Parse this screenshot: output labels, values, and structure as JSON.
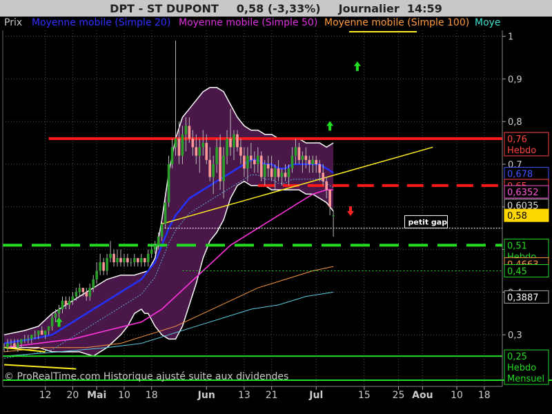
{
  "header": {
    "instrument": "DPT - ST DUPONT",
    "quote": "0,58 (-3,33%)",
    "period": "Journalier",
    "time": "14:59"
  },
  "legend": [
    {
      "label": "Prix",
      "color": "#c8c8c8"
    },
    {
      "label": "Moyenne mobile (Simple 20)",
      "color": "#3030ff"
    },
    {
      "label": "Moyenne mobile (Simple 50)",
      "color": "#e030e0"
    },
    {
      "label": "Moyenne mobile (Simple 100)",
      "color": "#ff9a40"
    },
    {
      "label": "Moye",
      "color": "#40e0d0"
    }
  ],
  "footer_note": "© ProRealTime.com Historique ajusté suite aux dividendes",
  "colors": {
    "background": "#000000",
    "bollinger_fill": "#4a1848",
    "bollinger_edge": "#ffffff",
    "candle_up": "#2aa02a",
    "candle_down": "#ff9999",
    "resistance": "#ff1a1a",
    "support": "#22dd22",
    "trendline": "#ffee22",
    "sma20": "#2233ff",
    "sma50": "#ff33dd",
    "sma100": "#ff9a40",
    "sma200": "#5ad0e0"
  },
  "chart_data": {
    "type": "candlestick",
    "y_axis": {
      "min": 0.2,
      "max": 1.0,
      "ticks": [
        "1",
        "0,9",
        "0,8",
        "0,7",
        "0,6",
        "0,5",
        "0,4",
        "0,3"
      ]
    },
    "x_axis": {
      "labels": [
        {
          "text": "12",
          "day": 12,
          "bold": false
        },
        {
          "text": "20",
          "day": 20,
          "bold": false
        },
        {
          "text": "Mai",
          "day": 27,
          "bold": true
        },
        {
          "text": "10",
          "day": 35,
          "bold": false
        },
        {
          "text": "18",
          "day": 43,
          "bold": false
        },
        {
          "text": "Jun",
          "day": 59,
          "bold": true
        },
        {
          "text": "13",
          "day": 70,
          "bold": false
        },
        {
          "text": "21",
          "day": 78,
          "bold": false
        },
        {
          "text": "Jul",
          "day": 91,
          "bold": true
        },
        {
          "text": "15",
          "day": 105,
          "bold": false
        },
        {
          "text": "25",
          "day": 115,
          "bold": false
        },
        {
          "text": "Aou",
          "day": 122,
          "bold": true
        },
        {
          "text": "10",
          "day": 132,
          "bold": false
        },
        {
          "text": "18",
          "day": 140,
          "bold": false
        }
      ]
    },
    "candles": [
      [
        0.27,
        0.28,
        0.26,
        0.27
      ],
      [
        0.27,
        0.29,
        0.26,
        0.28
      ],
      [
        0.28,
        0.29,
        0.27,
        0.28
      ],
      [
        0.28,
        0.29,
        0.27,
        0.27
      ],
      [
        0.27,
        0.29,
        0.26,
        0.28
      ],
      [
        0.28,
        0.29,
        0.27,
        0.29
      ],
      [
        0.29,
        0.3,
        0.28,
        0.29
      ],
      [
        0.29,
        0.3,
        0.28,
        0.29
      ],
      [
        0.29,
        0.3,
        0.28,
        0.3
      ],
      [
        0.3,
        0.31,
        0.29,
        0.3
      ],
      [
        0.3,
        0.31,
        0.29,
        0.31
      ],
      [
        0.31,
        0.32,
        0.3,
        0.3
      ],
      [
        0.3,
        0.31,
        0.29,
        0.31
      ],
      [
        0.31,
        0.32,
        0.3,
        0.32
      ],
      [
        0.32,
        0.35,
        0.31,
        0.34
      ],
      [
        0.34,
        0.36,
        0.33,
        0.35
      ],
      [
        0.35,
        0.37,
        0.34,
        0.36
      ],
      [
        0.36,
        0.39,
        0.35,
        0.38
      ],
      [
        0.38,
        0.39,
        0.36,
        0.37
      ],
      [
        0.37,
        0.39,
        0.36,
        0.38
      ],
      [
        0.38,
        0.4,
        0.37,
        0.39
      ],
      [
        0.39,
        0.41,
        0.38,
        0.4
      ],
      [
        0.4,
        0.42,
        0.39,
        0.41
      ],
      [
        0.41,
        0.4,
        0.39,
        0.4
      ],
      [
        0.4,
        0.41,
        0.38,
        0.39
      ],
      [
        0.39,
        0.42,
        0.38,
        0.41
      ],
      [
        0.41,
        0.44,
        0.4,
        0.43
      ],
      [
        0.43,
        0.47,
        0.42,
        0.45
      ],
      [
        0.45,
        0.49,
        0.44,
        0.47
      ],
      [
        0.47,
        0.48,
        0.44,
        0.45
      ],
      [
        0.45,
        0.49,
        0.44,
        0.48
      ],
      [
        0.48,
        0.52,
        0.47,
        0.49
      ],
      [
        0.49,
        0.5,
        0.46,
        0.47
      ],
      [
        0.47,
        0.5,
        0.46,
        0.48
      ],
      [
        0.48,
        0.5,
        0.46,
        0.47
      ],
      [
        0.47,
        0.49,
        0.46,
        0.48
      ],
      [
        0.48,
        0.49,
        0.46,
        0.47
      ],
      [
        0.47,
        0.48,
        0.46,
        0.47
      ],
      [
        0.47,
        0.49,
        0.46,
        0.48
      ],
      [
        0.48,
        0.48,
        0.46,
        0.47
      ],
      [
        0.47,
        0.49,
        0.46,
        0.48
      ],
      [
        0.48,
        0.48,
        0.46,
        0.47
      ],
      [
        0.47,
        0.5,
        0.46,
        0.49
      ],
      [
        0.49,
        0.51,
        0.48,
        0.5
      ],
      [
        0.5,
        0.52,
        0.49,
        0.51
      ],
      [
        0.51,
        0.54,
        0.5,
        0.53
      ],
      [
        0.53,
        0.57,
        0.52,
        0.56
      ],
      [
        0.56,
        0.62,
        0.55,
        0.61
      ],
      [
        0.61,
        0.72,
        0.6,
        0.7
      ],
      [
        0.7,
        0.76,
        0.69,
        0.74
      ],
      [
        0.74,
        0.99,
        0.72,
        0.76
      ],
      [
        0.76,
        0.8,
        0.7,
        0.72
      ],
      [
        0.72,
        0.79,
        0.7,
        0.77
      ],
      [
        0.77,
        0.81,
        0.73,
        0.79
      ],
      [
        0.79,
        0.81,
        0.75,
        0.76
      ],
      [
        0.76,
        0.78,
        0.72,
        0.74
      ],
      [
        0.74,
        0.77,
        0.7,
        0.72
      ],
      [
        0.72,
        0.76,
        0.68,
        0.74
      ],
      [
        0.74,
        0.78,
        0.72,
        0.75
      ],
      [
        0.75,
        0.77,
        0.7,
        0.71
      ],
      [
        0.71,
        0.74,
        0.66,
        0.67
      ],
      [
        0.67,
        0.72,
        0.63,
        0.7
      ],
      [
        0.7,
        0.76,
        0.68,
        0.74
      ],
      [
        0.74,
        0.77,
        0.64,
        0.66
      ],
      [
        0.66,
        0.74,
        0.62,
        0.72
      ],
      [
        0.72,
        0.78,
        0.7,
        0.76
      ],
      [
        0.76,
        0.83,
        0.72,
        0.74
      ],
      [
        0.74,
        0.78,
        0.71,
        0.77
      ],
      [
        0.77,
        0.78,
        0.73,
        0.74
      ],
      [
        0.74,
        0.76,
        0.7,
        0.72
      ],
      [
        0.72,
        0.74,
        0.67,
        0.69
      ],
      [
        0.69,
        0.74,
        0.66,
        0.72
      ],
      [
        0.72,
        0.75,
        0.69,
        0.71
      ],
      [
        0.71,
        0.73,
        0.68,
        0.7
      ],
      [
        0.7,
        0.74,
        0.68,
        0.72
      ],
      [
        0.72,
        0.73,
        0.66,
        0.67
      ],
      [
        0.67,
        0.71,
        0.65,
        0.7
      ],
      [
        0.7,
        0.72,
        0.67,
        0.69
      ],
      [
        0.69,
        0.72,
        0.66,
        0.67
      ],
      [
        0.67,
        0.7,
        0.64,
        0.69
      ],
      [
        0.69,
        0.71,
        0.66,
        0.67
      ],
      [
        0.67,
        0.69,
        0.65,
        0.68
      ],
      [
        0.68,
        0.7,
        0.66,
        0.67
      ],
      [
        0.67,
        0.7,
        0.65,
        0.69
      ],
      [
        0.69,
        0.74,
        0.68,
        0.72
      ],
      [
        0.72,
        0.76,
        0.7,
        0.74
      ],
      [
        0.74,
        0.75,
        0.7,
        0.71
      ],
      [
        0.71,
        0.73,
        0.68,
        0.72
      ],
      [
        0.72,
        0.74,
        0.69,
        0.71
      ],
      [
        0.71,
        0.72,
        0.68,
        0.7
      ],
      [
        0.7,
        0.72,
        0.68,
        0.71
      ],
      [
        0.71,
        0.72,
        0.68,
        0.7
      ],
      [
        0.7,
        0.71,
        0.66,
        0.68
      ],
      [
        0.68,
        0.7,
        0.65,
        0.66
      ],
      [
        0.66,
        0.67,
        0.62,
        0.64
      ],
      [
        0.64,
        0.64,
        0.58,
        0.6
      ],
      [
        0.58,
        0.59,
        0.53,
        0.58
      ]
    ],
    "bollinger_upper": [
      [
        0,
        0.3
      ],
      [
        6,
        0.31
      ],
      [
        10,
        0.32
      ],
      [
        14,
        0.35
      ],
      [
        20,
        0.38
      ],
      [
        26,
        0.41
      ],
      [
        30,
        0.43
      ],
      [
        34,
        0.44
      ],
      [
        38,
        0.44
      ],
      [
        42,
        0.45
      ],
      [
        44,
        0.48
      ],
      [
        46,
        0.57
      ],
      [
        48,
        0.68
      ],
      [
        50,
        0.76
      ],
      [
        52,
        0.81
      ],
      [
        54,
        0.83
      ],
      [
        56,
        0.85
      ],
      [
        58,
        0.87
      ],
      [
        60,
        0.88
      ],
      [
        62,
        0.88
      ],
      [
        64,
        0.87
      ],
      [
        66,
        0.84
      ],
      [
        68,
        0.81
      ],
      [
        70,
        0.79
      ],
      [
        72,
        0.78
      ],
      [
        74,
        0.78
      ],
      [
        76,
        0.77
      ],
      [
        78,
        0.77
      ],
      [
        80,
        0.76
      ],
      [
        82,
        0.76
      ],
      [
        84,
        0.76
      ],
      [
        86,
        0.76
      ],
      [
        88,
        0.75
      ],
      [
        90,
        0.75
      ],
      [
        92,
        0.75
      ],
      [
        94,
        0.74
      ],
      [
        96,
        0.75
      ]
    ],
    "bollinger_lower": [
      [
        0,
        0.27
      ],
      [
        6,
        0.27
      ],
      [
        10,
        0.27
      ],
      [
        14,
        0.26
      ],
      [
        18,
        0.26
      ],
      [
        22,
        0.26
      ],
      [
        26,
        0.25
      ],
      [
        30,
        0.27
      ],
      [
        34,
        0.3
      ],
      [
        36,
        0.32
      ],
      [
        38,
        0.35
      ],
      [
        40,
        0.36
      ],
      [
        41,
        0.35
      ],
      [
        42,
        0.35
      ],
      [
        44,
        0.32
      ],
      [
        46,
        0.3
      ],
      [
        48,
        0.29
      ],
      [
        50,
        0.29
      ],
      [
        52,
        0.32
      ],
      [
        54,
        0.37
      ],
      [
        56,
        0.42
      ],
      [
        58,
        0.48
      ],
      [
        60,
        0.52
      ],
      [
        62,
        0.54
      ],
      [
        64,
        0.57
      ],
      [
        66,
        0.62
      ],
      [
        68,
        0.65
      ],
      [
        70,
        0.66
      ],
      [
        72,
        0.65
      ],
      [
        74,
        0.65
      ],
      [
        76,
        0.65
      ],
      [
        78,
        0.64
      ],
      [
        80,
        0.64
      ],
      [
        82,
        0.64
      ],
      [
        84,
        0.64
      ],
      [
        86,
        0.64
      ],
      [
        88,
        0.63
      ],
      [
        90,
        0.63
      ],
      [
        92,
        0.62
      ],
      [
        94,
        0.61
      ],
      [
        96,
        0.59
      ]
    ],
    "sma20": [
      [
        0,
        0.28
      ],
      [
        8,
        0.29
      ],
      [
        14,
        0.3
      ],
      [
        18,
        0.32
      ],
      [
        24,
        0.35
      ],
      [
        30,
        0.38
      ],
      [
        36,
        0.41
      ],
      [
        40,
        0.43
      ],
      [
        42,
        0.45
      ],
      [
        44,
        0.47
      ],
      [
        46,
        0.51
      ],
      [
        48,
        0.55
      ],
      [
        50,
        0.58
      ],
      [
        52,
        0.6
      ],
      [
        54,
        0.62
      ],
      [
        56,
        0.63
      ],
      [
        58,
        0.64
      ],
      [
        60,
        0.65
      ],
      [
        62,
        0.66
      ],
      [
        64,
        0.67
      ],
      [
        66,
        0.68
      ],
      [
        68,
        0.69
      ],
      [
        70,
        0.7
      ],
      [
        72,
        0.71
      ],
      [
        74,
        0.71
      ],
      [
        76,
        0.7
      ],
      [
        78,
        0.7
      ],
      [
        80,
        0.69
      ],
      [
        82,
        0.69
      ],
      [
        84,
        0.7
      ],
      [
        86,
        0.7
      ],
      [
        88,
        0.7
      ],
      [
        90,
        0.7
      ],
      [
        92,
        0.7
      ],
      [
        94,
        0.69
      ],
      [
        96,
        0.68
      ]
    ],
    "sma50": [
      [
        0,
        0.27
      ],
      [
        10,
        0.28
      ],
      [
        20,
        0.29
      ],
      [
        30,
        0.31
      ],
      [
        40,
        0.33
      ],
      [
        46,
        0.36
      ],
      [
        50,
        0.39
      ],
      [
        54,
        0.42
      ],
      [
        58,
        0.45
      ],
      [
        62,
        0.48
      ],
      [
        66,
        0.51
      ],
      [
        70,
        0.53
      ],
      [
        74,
        0.55
      ],
      [
        78,
        0.57
      ],
      [
        82,
        0.59
      ],
      [
        86,
        0.61
      ],
      [
        90,
        0.63
      ],
      [
        94,
        0.64
      ],
      [
        96,
        0.64
      ]
    ],
    "sma100": [
      [
        0,
        0.26
      ],
      [
        12,
        0.27
      ],
      [
        24,
        0.27
      ],
      [
        34,
        0.28
      ],
      [
        42,
        0.3
      ],
      [
        50,
        0.32
      ],
      [
        58,
        0.35
      ],
      [
        66,
        0.38
      ],
      [
        74,
        0.41
      ],
      [
        82,
        0.43
      ],
      [
        90,
        0.45
      ],
      [
        96,
        0.46
      ]
    ],
    "sma200": [
      [
        0,
        0.25
      ],
      [
        16,
        0.26
      ],
      [
        30,
        0.27
      ],
      [
        40,
        0.28
      ],
      [
        48,
        0.3
      ],
      [
        56,
        0.32
      ],
      [
        64,
        0.34
      ],
      [
        72,
        0.36
      ],
      [
        80,
        0.37
      ],
      [
        88,
        0.39
      ],
      [
        96,
        0.4
      ]
    ],
    "resistance_level": 0.76,
    "dashed_resistance_level": 0.65,
    "support_level": 0.51,
    "weekly_level": 0.25,
    "monthly_level": 0.2,
    "gap_level": 0.55,
    "support_dotted_level": 0.45,
    "trendline": [
      [
        46,
        0.56
      ],
      [
        125,
        0.74
      ]
    ],
    "left_yellow_lines": [
      [
        [
          0,
          0.27
        ],
        [
          12,
          0.26
        ]
      ],
      [
        [
          0,
          0.23
        ],
        [
          21,
          0.22
        ]
      ]
    ],
    "arrows": [
      {
        "day": 103,
        "value": 0.93,
        "dir": "up",
        "color": "#22dd22"
      },
      {
        "day": 95,
        "value": 0.79,
        "dir": "up",
        "color": "#22dd22"
      },
      {
        "day": 101,
        "value": 0.59,
        "dir": "down",
        "color": "#ff2222"
      },
      {
        "day": 16,
        "value": 0.33,
        "dir": "up",
        "color": "#22dd22"
      }
    ],
    "annotation": {
      "text": "petit gap",
      "day": 117,
      "value": 0.565
    },
    "price_labels": [
      {
        "text": "0,76",
        "sub": "Hebdo",
        "value": 0.76,
        "bg": "#000000",
        "fg": "#ff4444",
        "border": "#ff4444"
      },
      {
        "text": "0,678",
        "value": 0.678,
        "bg": "#000000",
        "fg": "#4455ff",
        "border": "#4455ff"
      },
      {
        "text": "0,65",
        "value": 0.65,
        "bg": "#000000",
        "fg": "#ff4444",
        "border": "#ff4444"
      },
      {
        "text": "0,6352",
        "value": 0.6352,
        "bg": "#000000",
        "fg": "#ff55dd",
        "border": "#ff55dd"
      },
      {
        "text": "0,6035",
        "value": 0.6035,
        "bg": "#000000",
        "fg": "#dddddd",
        "border": "#aaaaaa"
      },
      {
        "text": "0,58",
        "value": 0.58,
        "bg": "#ffd800",
        "fg": "#000000",
        "border": "#ffd800"
      },
      {
        "text": "0,51",
        "sub": "Hebdo",
        "value": 0.51,
        "bg": "#000000",
        "fg": "#22dd22",
        "border": "#22dd22"
      },
      {
        "text": "0,4663",
        "value": 0.4663,
        "bg": "#000000",
        "fg": "#ff9a40",
        "border": "#ff9a40"
      },
      {
        "text": "0,45",
        "value": 0.45,
        "bg": "#000000",
        "fg": "#22dd22",
        "border": "#22dd22"
      },
      {
        "text": "0,3887",
        "value": 0.3887,
        "bg": "#000000",
        "fg": "#ffffff",
        "border": "#aaaaaa"
      },
      {
        "text": "0,25",
        "sub": "Hebdo",
        "sub2": "Mensuel",
        "value": 0.25,
        "bg": "#000000",
        "fg": "#22dd22",
        "border": "#22dd22"
      }
    ]
  }
}
